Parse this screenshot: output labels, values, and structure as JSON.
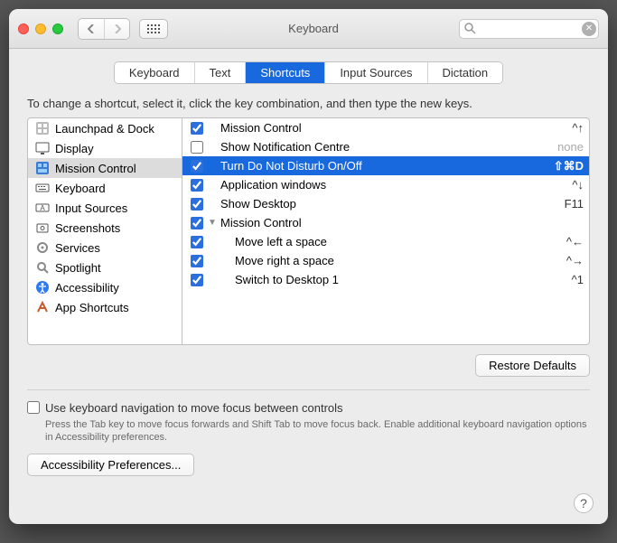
{
  "window": {
    "title": "Keyboard"
  },
  "search": {
    "placeholder": ""
  },
  "tabs": [
    {
      "label": "Keyboard",
      "active": false
    },
    {
      "label": "Text",
      "active": false
    },
    {
      "label": "Shortcuts",
      "active": true
    },
    {
      "label": "Input Sources",
      "active": false
    },
    {
      "label": "Dictation",
      "active": false
    }
  ],
  "instructions": "To change a shortcut, select it, click the key combination, and then type the new keys.",
  "categories": [
    {
      "label": "Launchpad & Dock",
      "icon": "launchpad",
      "selected": false
    },
    {
      "label": "Display",
      "icon": "display",
      "selected": false
    },
    {
      "label": "Mission Control",
      "icon": "mc",
      "selected": true
    },
    {
      "label": "Keyboard",
      "icon": "keyboard",
      "selected": false
    },
    {
      "label": "Input Sources",
      "icon": "input",
      "selected": false
    },
    {
      "label": "Screenshots",
      "icon": "screenshot",
      "selected": false
    },
    {
      "label": "Services",
      "icon": "services",
      "selected": false
    },
    {
      "label": "Spotlight",
      "icon": "spotlight",
      "selected": false
    },
    {
      "label": "Accessibility",
      "icon": "accessibility",
      "selected": false
    },
    {
      "label": "App Shortcuts",
      "icon": "apps",
      "selected": false
    }
  ],
  "shortcuts": [
    {
      "checked": true,
      "disclosure": "",
      "label": "Mission Control",
      "shortcut": "^↑",
      "indent": 0,
      "selected": false
    },
    {
      "checked": false,
      "disclosure": "",
      "label": "Show Notification Centre",
      "shortcut": "none",
      "indent": 0,
      "selected": false,
      "none": true
    },
    {
      "checked": true,
      "disclosure": "",
      "label": "Turn Do Not Disturb On/Off",
      "shortcut": "⇧⌘D",
      "indent": 0,
      "selected": true
    },
    {
      "checked": true,
      "disclosure": "",
      "label": "Application windows",
      "shortcut": "^↓",
      "indent": 0,
      "selected": false
    },
    {
      "checked": true,
      "disclosure": "",
      "label": "Show Desktop",
      "shortcut": "F11",
      "indent": 0,
      "selected": false
    },
    {
      "checked": true,
      "disclosure": "▼",
      "label": "Mission Control",
      "shortcut": "",
      "indent": 0,
      "selected": false
    },
    {
      "checked": true,
      "disclosure": "",
      "label": "Move left a space",
      "shortcut": "^←",
      "indent": 1,
      "selected": false
    },
    {
      "checked": true,
      "disclosure": "",
      "label": "Move right a space",
      "shortcut": "^→",
      "indent": 1,
      "selected": false
    },
    {
      "checked": true,
      "disclosure": "",
      "label": "Switch to Desktop 1",
      "shortcut": "^1",
      "indent": 1,
      "selected": false
    }
  ],
  "restore_label": "Restore Defaults",
  "kbnav_checkbox_label": "Use keyboard navigation to move focus between controls",
  "kbnav_hint": "Press the Tab key to move focus forwards and Shift Tab to move focus back. Enable additional keyboard navigation options in Accessibility preferences.",
  "accessibility_btn": "Accessibility Preferences...",
  "icons": {
    "launchpad": "#555",
    "display": "#555",
    "mc": "#3a7bd5",
    "keyboard": "#555",
    "input": "#555",
    "screenshot": "#555",
    "services": "#666",
    "spotlight": "#888",
    "accessibility": "#2d7bf0",
    "apps": "#c85c2e"
  }
}
